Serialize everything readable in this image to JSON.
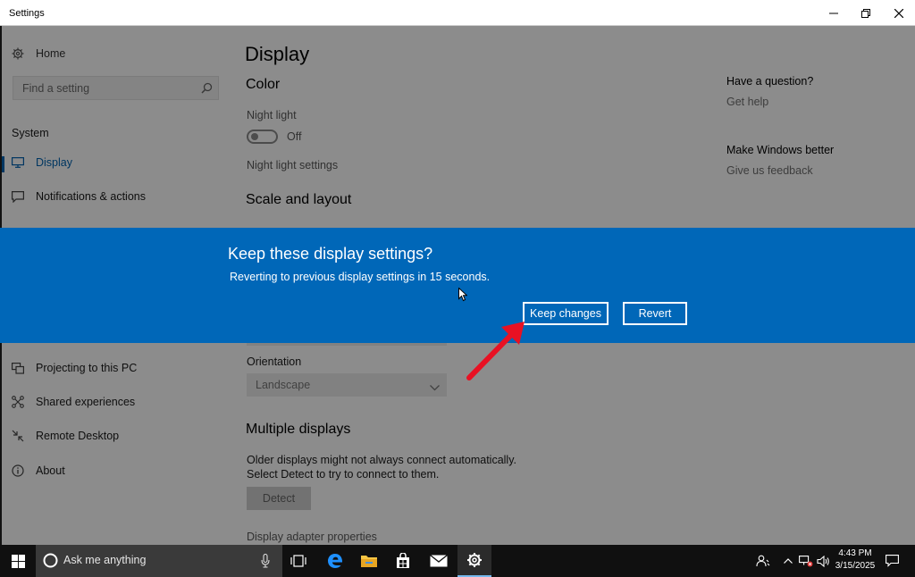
{
  "window": {
    "title": "Settings"
  },
  "sidebar": {
    "home_label": "Home",
    "search_placeholder": "Find a setting",
    "section_label": "System",
    "items": [
      {
        "label": "Display",
        "icon": "monitor-icon",
        "active": true
      },
      {
        "label": "Notifications & actions",
        "icon": "message-icon"
      },
      {
        "label": "Projecting to this PC",
        "icon": "projecting-icon"
      },
      {
        "label": "Shared experiences",
        "icon": "shared-icon"
      },
      {
        "label": "Remote Desktop",
        "icon": "remote-icon"
      },
      {
        "label": "About",
        "icon": "info-icon"
      }
    ]
  },
  "main": {
    "title": "Display",
    "color_heading": "Color",
    "night_light_label": "Night light",
    "night_light_state": "Off",
    "night_light_settings": "Night light settings",
    "scale_heading": "Scale and layout",
    "orientation_label": "Orientation",
    "orientation_value": "Landscape",
    "multiple_heading": "Multiple displays",
    "multiple_text": "Older displays might not always connect automatically. Select Detect to try to connect to them.",
    "detect_label": "Detect",
    "adapter_link": "Display adapter properties"
  },
  "right_panel": {
    "question_heading": "Have a question?",
    "get_help": "Get help",
    "better_heading": "Make Windows better",
    "feedback": "Give us feedback"
  },
  "dialog": {
    "title": "Keep these display settings?",
    "subtitle": "Reverting to previous display settings in 15 seconds.",
    "keep_label": "Keep changes",
    "revert_label": "Revert",
    "background_color": "#0067b8"
  },
  "annotation": {
    "arrow_color": "#e81123"
  },
  "taskbar": {
    "search_placeholder": "Ask me anything",
    "time": "4:43 PM",
    "date": "3/15/2025"
  }
}
